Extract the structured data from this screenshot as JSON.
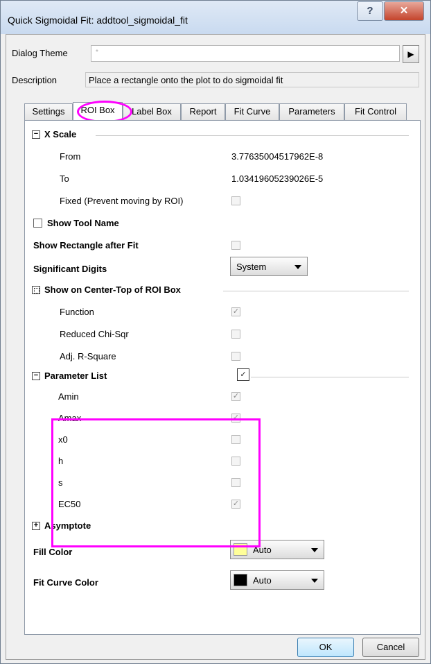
{
  "window": {
    "title": "Quick Sigmoidal Fit: addtool_sigmoidal_fit"
  },
  "titlebar": {
    "help_glyph": "?",
    "close_glyph": "✕"
  },
  "dialog_theme": {
    "label": "Dialog Theme",
    "value": "*",
    "arrow": "▶"
  },
  "description": {
    "label": "Description",
    "value": "Place a rectangle onto the plot to do sigmoidal fit"
  },
  "tabs": [
    "Settings",
    "ROI Box",
    "Label Box",
    "Report",
    "Fit Curve",
    "Parameters",
    "Fit Control"
  ],
  "active_tab": "ROI Box",
  "x_scale": {
    "header": "X Scale",
    "from_label": "From",
    "from_value": "3.77635004517962E-8",
    "to_label": "To",
    "to_value": "1.03419605239026E-5",
    "fixed_label": "Fixed (Prevent moving by ROI)"
  },
  "show_tool_name": {
    "label": "Show Tool Name"
  },
  "show_rectangle": {
    "label": "Show Rectangle after Fit"
  },
  "significant_digits": {
    "label": "Significant Digits",
    "value": "System"
  },
  "center_top": {
    "header": "Show on Center-Top of ROI Box",
    "items": [
      {
        "label": "Function",
        "checked": true
      },
      {
        "label": "Reduced Chi-Sqr",
        "checked": false
      },
      {
        "label": "Adj. R-Square",
        "checked": false
      }
    ]
  },
  "parameter_list": {
    "header": "Parameter List",
    "checked": true,
    "items": [
      {
        "label": "Amin",
        "checked": true
      },
      {
        "label": "Amax",
        "checked": true
      },
      {
        "label": "x0",
        "checked": false
      },
      {
        "label": "h",
        "checked": false
      },
      {
        "label": "s",
        "checked": false
      },
      {
        "label": "EC50",
        "checked": true
      }
    ]
  },
  "asymptote": {
    "header": "Asymptote"
  },
  "fill_color": {
    "label": "Fill Color",
    "value": "Auto",
    "swatch": "#ffff99"
  },
  "fit_curve_color": {
    "label": "Fit Curve Color",
    "value": "Auto",
    "swatch": "#000000"
  },
  "buttons": {
    "ok": "OK",
    "cancel": "Cancel"
  },
  "colors": {
    "highlight": "#ff00ff"
  }
}
